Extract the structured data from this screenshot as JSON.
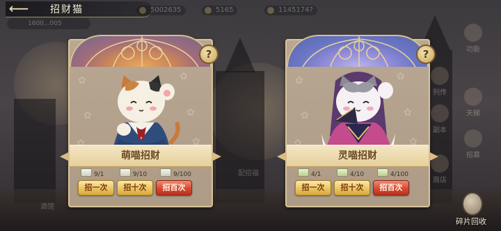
{
  "header": {
    "back_glyph": "⟵",
    "title": "招财猫",
    "player_id": "1600...005",
    "resources": [
      "5002635",
      "5165",
      "1145174?"
    ]
  },
  "side_menu": [
    "功能",
    "列传",
    "天梯",
    "副本",
    "招募",
    "商店"
  ],
  "cards": [
    {
      "name": "萌喵招财",
      "counters": [
        "9/1",
        "9/10",
        "9/100"
      ],
      "buttons": [
        "招一次",
        "招十次",
        "招百次"
      ]
    },
    {
      "name": "灵喵招财",
      "counters": [
        "4/1",
        "4/10",
        "4/100"
      ],
      "buttons": [
        "招一次",
        "招十次",
        "招百次"
      ]
    }
  ],
  "help_glyph": "?",
  "recycle": {
    "label": "碎片回收"
  },
  "colors": {
    "gold_button": "#e9c25e",
    "red_button": "#d2452f",
    "panel": "#b8a792",
    "banner": "#f0e0b8"
  }
}
